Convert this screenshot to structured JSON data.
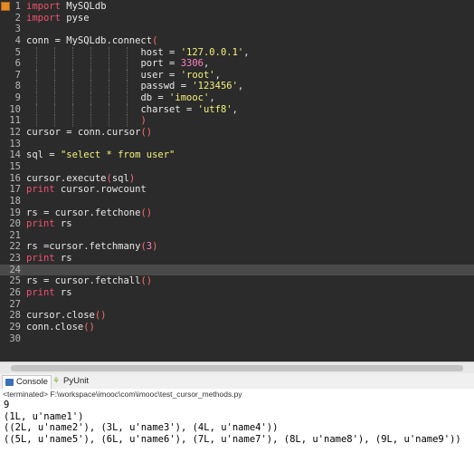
{
  "editor": {
    "lines": [
      {
        "n": "1",
        "t": [
          [
            "kw",
            "import"
          ],
          [
            "txt",
            " MySQLdb"
          ]
        ]
      },
      {
        "n": "2",
        "t": [
          [
            "kw",
            "import"
          ],
          [
            "txt",
            " pyse"
          ]
        ]
      },
      {
        "n": "3",
        "t": []
      },
      {
        "n": "4",
        "t": [
          [
            "txt",
            "conn = MySQLdb.connect"
          ],
          [
            "par",
            "("
          ]
        ]
      },
      {
        "n": "5",
        "t": [
          [
            "pad",
            "                    "
          ],
          [
            "txt",
            "host = "
          ],
          [
            "str",
            "'127.0.0.1'"
          ],
          [
            "txt",
            ","
          ]
        ]
      },
      {
        "n": "6",
        "t": [
          [
            "pad",
            "                    "
          ],
          [
            "txt",
            "port = "
          ],
          [
            "num",
            "3306"
          ],
          [
            "txt",
            ","
          ]
        ]
      },
      {
        "n": "7",
        "t": [
          [
            "pad",
            "                    "
          ],
          [
            "txt",
            "user = "
          ],
          [
            "str",
            "'root'"
          ],
          [
            "txt",
            ","
          ]
        ]
      },
      {
        "n": "8",
        "t": [
          [
            "pad",
            "                    "
          ],
          [
            "txt",
            "passwd = "
          ],
          [
            "str",
            "'123456'"
          ],
          [
            "txt",
            ","
          ]
        ]
      },
      {
        "n": "9",
        "t": [
          [
            "pad",
            "                    "
          ],
          [
            "txt",
            "db = "
          ],
          [
            "str",
            "'imooc'"
          ],
          [
            "txt",
            ","
          ]
        ]
      },
      {
        "n": "10",
        "t": [
          [
            "pad",
            "                    "
          ],
          [
            "txt",
            "charset = "
          ],
          [
            "str",
            "'utf8'"
          ],
          [
            "txt",
            ","
          ]
        ]
      },
      {
        "n": "11",
        "t": [
          [
            "pad",
            "                    "
          ],
          [
            "par",
            ")"
          ]
        ]
      },
      {
        "n": "12",
        "t": [
          [
            "txt",
            "cursor = conn.cursor"
          ],
          [
            "par",
            "()"
          ]
        ]
      },
      {
        "n": "13",
        "t": []
      },
      {
        "n": "14",
        "t": [
          [
            "txt",
            "sql = "
          ],
          [
            "str",
            "\"select * from user\""
          ]
        ]
      },
      {
        "n": "15",
        "t": []
      },
      {
        "n": "16",
        "t": [
          [
            "txt",
            "cursor.execute"
          ],
          [
            "par",
            "("
          ],
          [
            "txt",
            "sql"
          ],
          [
            "par",
            ")"
          ]
        ]
      },
      {
        "n": "17",
        "t": [
          [
            "kw",
            "print"
          ],
          [
            "txt",
            " cursor.rowcount"
          ]
        ]
      },
      {
        "n": "18",
        "t": []
      },
      {
        "n": "19",
        "t": [
          [
            "txt",
            "rs = cursor.fetchone"
          ],
          [
            "par",
            "()"
          ]
        ]
      },
      {
        "n": "20",
        "t": [
          [
            "kw",
            "print"
          ],
          [
            "txt",
            " rs"
          ]
        ]
      },
      {
        "n": "21",
        "t": []
      },
      {
        "n": "22",
        "t": [
          [
            "txt",
            "rs =cursor.fetchmany"
          ],
          [
            "par",
            "("
          ],
          [
            "num",
            "3"
          ],
          [
            "par",
            ")"
          ]
        ]
      },
      {
        "n": "23",
        "t": [
          [
            "kw",
            "print"
          ],
          [
            "txt",
            " rs"
          ]
        ]
      },
      {
        "n": "24",
        "t": [],
        "hl": true
      },
      {
        "n": "25",
        "t": [
          [
            "txt",
            "rs = cursor.fetchall"
          ],
          [
            "par",
            "()"
          ]
        ]
      },
      {
        "n": "26",
        "t": [
          [
            "kw",
            "print"
          ],
          [
            "txt",
            " rs"
          ]
        ]
      },
      {
        "n": "27",
        "t": []
      },
      {
        "n": "28",
        "t": [
          [
            "txt",
            "cursor.close"
          ],
          [
            "par",
            "()"
          ]
        ]
      },
      {
        "n": "29",
        "t": [
          [
            "txt",
            "conn.close"
          ],
          [
            "par",
            "()"
          ]
        ]
      },
      {
        "n": "30",
        "t": []
      }
    ]
  },
  "panel": {
    "tabs": [
      {
        "label": "Console",
        "icon": "console-icon",
        "active": true
      },
      {
        "label": "PyUnit",
        "icon": "pyunit-icon",
        "active": false
      }
    ],
    "status": "<terminated> F:\\workspace\\imooc\\com\\imooc\\test_cursor_methods.py",
    "output": [
      "9",
      "(1L, u'name1')",
      "((2L, u'name2'), (3L, u'name3'), (4L, u'name4'))",
      "((5L, u'name5'), (6L, u'name6'), (7L, u'name7'), (8L, u'name8'), (9L, u'name9'))"
    ]
  },
  "colors": {
    "editor_bg": "#2b2b2b",
    "keyword": "#f2506e",
    "string": "#f4f27a",
    "number": "#ff80c0",
    "paren": "#ff6b6b"
  }
}
